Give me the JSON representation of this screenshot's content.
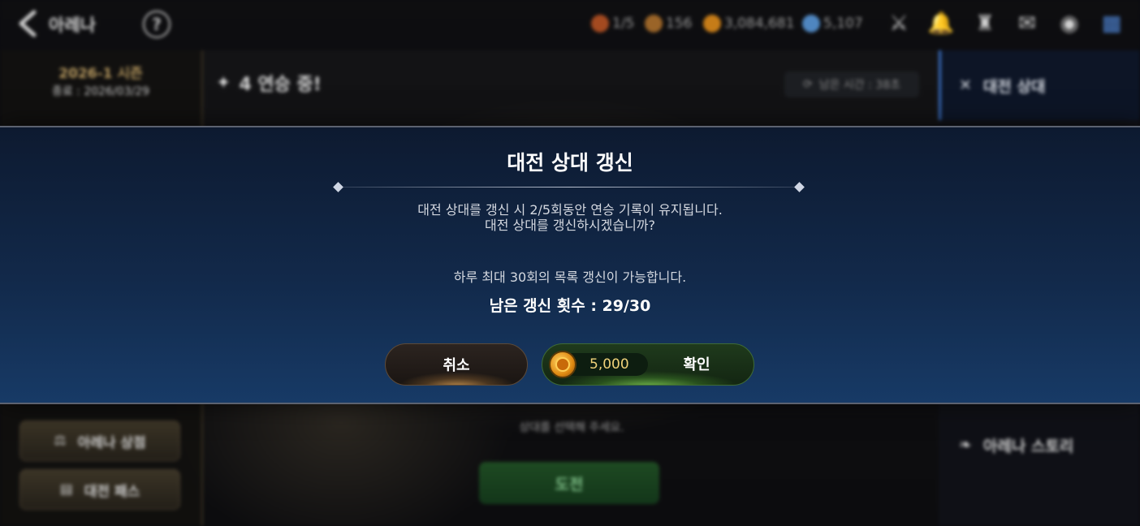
{
  "header": {
    "title": "아레나",
    "resources": [
      {
        "name": "ticket",
        "value": "1/5",
        "color": "#c0602a"
      },
      {
        "name": "trophy",
        "value": "156",
        "color": "#b07030"
      },
      {
        "name": "gold",
        "value": "3,084,681",
        "color": "#d98a20"
      },
      {
        "name": "gem",
        "value": "5,107",
        "color": "#6aa0d8"
      }
    ],
    "icons": [
      "back-icon",
      "help-icon",
      "battle-icon",
      "bell-icon",
      "guild-icon",
      "mail-icon",
      "chat-icon",
      "menu-grid-icon"
    ]
  },
  "left_panel": {
    "season": "2026-1 시즌",
    "season_end": "종료 : 2026/03/29",
    "buttons": [
      "아레나 상점",
      "대전 패스"
    ]
  },
  "main": {
    "streak": "4 연승 중!",
    "timer": "남은 시간 : 38초",
    "select_hint": "상대를 선택해 주세요.",
    "challenge": "도전"
  },
  "right_panel": {
    "active": "대전 상대",
    "story": "아레나 스토리"
  },
  "modal": {
    "title": "대전 상대 갱신",
    "message_line1": "대전 상대를 갱신 시 2/5회동안 연승 기록이 유지됩니다.",
    "message_line2": "대전 상대를 갱신하시겠습니까?",
    "daily_limit": "하루 최대 30회의 목록 갱신이 가능합니다.",
    "remaining": "남은 갱신 횟수 : 29/30",
    "cancel_label": "취소",
    "confirm_label": "확인",
    "cost": "5,000",
    "cost_icon": "gold-coin-icon"
  },
  "colors": {
    "modal_bg": "#12294a",
    "confirm_green": "#3e6a36",
    "cancel_brown": "#5d4a38",
    "accent_blue": "#3b72c8"
  }
}
